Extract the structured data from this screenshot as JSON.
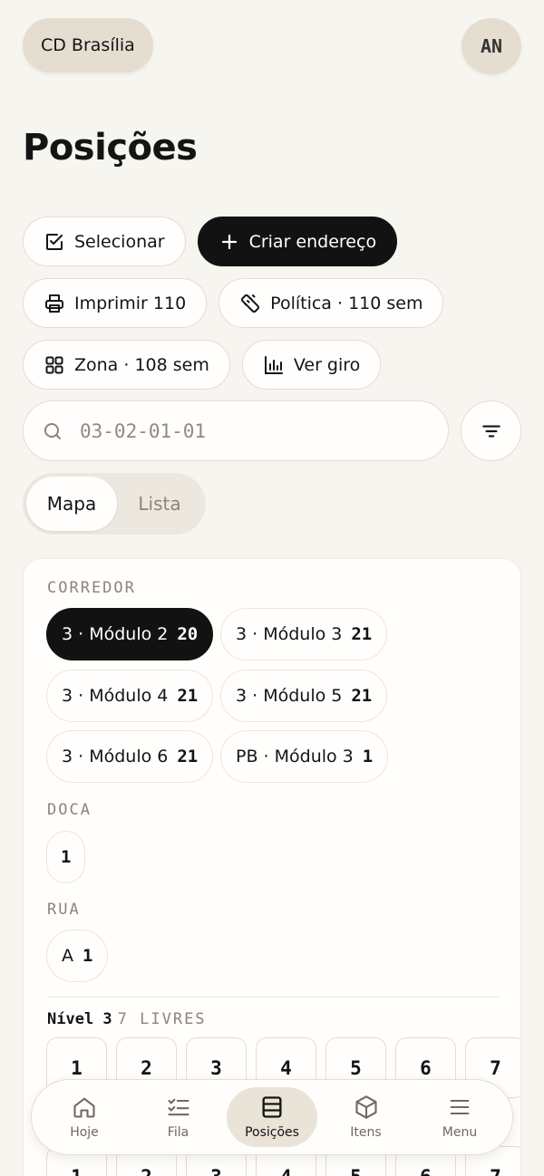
{
  "header": {
    "site": "CD Brasília",
    "avatar_initials": "AN"
  },
  "page_title": "Posições",
  "actions": [
    {
      "label": "Selecionar",
      "icon": "checkbox-icon",
      "primary": false
    },
    {
      "label": "Criar endereço",
      "icon": "plus-icon",
      "primary": true
    },
    {
      "label": "Imprimir 110",
      "icon": "printer-icon",
      "primary": false
    },
    {
      "label": "Política · 110 sem",
      "icon": "ruler-icon",
      "primary": false
    },
    {
      "label": "Zona · 108 sem",
      "icon": "grid-icon",
      "primary": false
    },
    {
      "label": "Ver giro",
      "icon": "bar-chart-icon",
      "primary": false
    }
  ],
  "search": {
    "placeholder": "03-02-01-01",
    "value": ""
  },
  "view_toggle": {
    "options": [
      "Mapa",
      "Lista"
    ],
    "selected": "Mapa"
  },
  "map": {
    "sections": [
      {
        "label": "CORREDOR",
        "chips": [
          {
            "name": "3 · Módulo 2",
            "count": "20",
            "selected": true
          },
          {
            "name": "3 · Módulo 3",
            "count": "21",
            "selected": false
          },
          {
            "name": "3 · Módulo 4",
            "count": "21",
            "selected": false
          },
          {
            "name": "3 · Módulo 5",
            "count": "21",
            "selected": false
          },
          {
            "name": "3 · Módulo 6",
            "count": "21",
            "selected": false
          },
          {
            "name": "PB · Módulo 3",
            "count": "1",
            "selected": false
          }
        ]
      },
      {
        "label": "DOCA",
        "chips": [
          {
            "name": "",
            "count": "1",
            "selected": false
          }
        ]
      },
      {
        "label": "RUA",
        "chips": [
          {
            "name": "A",
            "count": "1",
            "selected": false
          }
        ]
      }
    ],
    "level": {
      "label": "Nível 3",
      "free": "7 LIVRES",
      "slots": [
        "1",
        "2",
        "3",
        "4",
        "5",
        "6",
        "7"
      ]
    },
    "next_level_slots": [
      "1",
      "2",
      "3",
      "4",
      "5",
      "6",
      "7"
    ]
  },
  "bottom_nav": [
    {
      "label": "Hoje",
      "icon": "home-icon",
      "active": false
    },
    {
      "label": "Fila",
      "icon": "checklist-icon",
      "active": false
    },
    {
      "label": "Posições",
      "icon": "rack-icon",
      "active": true
    },
    {
      "label": "Itens",
      "icon": "box-icon",
      "active": false
    },
    {
      "label": "Menu",
      "icon": "menu-icon",
      "active": false
    }
  ],
  "colors": {
    "background": "#f7f5f0",
    "primary": "#121212",
    "surface": "#fffefc",
    "muted": "#8a857d",
    "active_nav": "#e9e3d8"
  }
}
